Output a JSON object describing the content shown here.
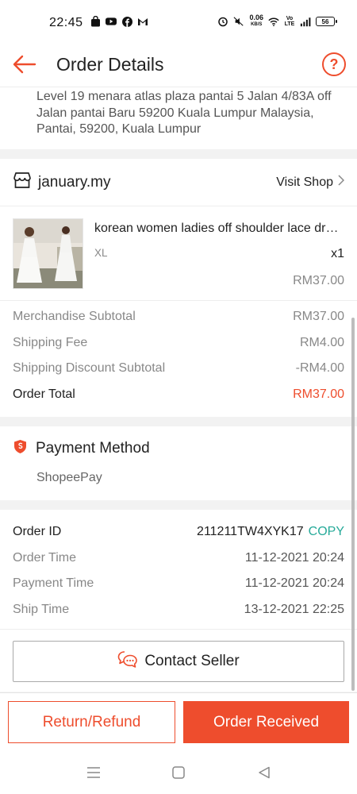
{
  "status_bar": {
    "time": "22:45",
    "net_speed_value": "0.06",
    "net_speed_unit": "KB/S",
    "battery": "56"
  },
  "header": {
    "title": "Order Details",
    "help_label": "?"
  },
  "address": {
    "text": "Level 19 menara atlas plaza pantai 5 Jalan 4/83A off Jalan pantai Baru 59200 Kuala Lumpur Malaysia, Pantai, 59200, Kuala Lumpur"
  },
  "shop": {
    "name": "january.my",
    "visit_label": "Visit Shop"
  },
  "item": {
    "name": "korean women ladies off shoulder lace dress",
    "variant": "XL",
    "quantity": "x1",
    "price": "RM37.00"
  },
  "summary": {
    "rows": [
      {
        "label": "Merchandise Subtotal",
        "value": "RM37.00"
      },
      {
        "label": "Shipping Fee",
        "value": "RM4.00"
      },
      {
        "label": "Shipping Discount Subtotal",
        "value": "-RM4.00"
      }
    ],
    "total_label": "Order Total",
    "total_value": "RM37.00"
  },
  "payment": {
    "title": "Payment Method",
    "method": "ShopeePay"
  },
  "order_info": {
    "id_label": "Order ID",
    "id_value": "211211TW4XYK17",
    "copy_label": "COPY",
    "rows": [
      {
        "label": "Order Time",
        "value": "11-12-2021 20:24"
      },
      {
        "label": "Payment Time",
        "value": "11-12-2021 20:24"
      },
      {
        "label": "Ship Time",
        "value": "13-12-2021 22:25"
      }
    ]
  },
  "contact": {
    "label": "Contact Seller"
  },
  "actions": {
    "refund_label": "Return/Refund",
    "received_label": "Order Received"
  },
  "colors": {
    "accent": "#ee4d2d",
    "copy": "#26aa99"
  },
  "icons": {
    "back": "arrow-left-icon",
    "help": "question-circle-icon",
    "shop": "shop-icon",
    "visit_chevron": "chevron-right-icon",
    "payment": "shield-icon",
    "contact": "chat-bubbles-icon",
    "nav_menu": "menu-icon",
    "nav_home": "home-square-icon",
    "nav_back": "triangle-back-icon"
  }
}
